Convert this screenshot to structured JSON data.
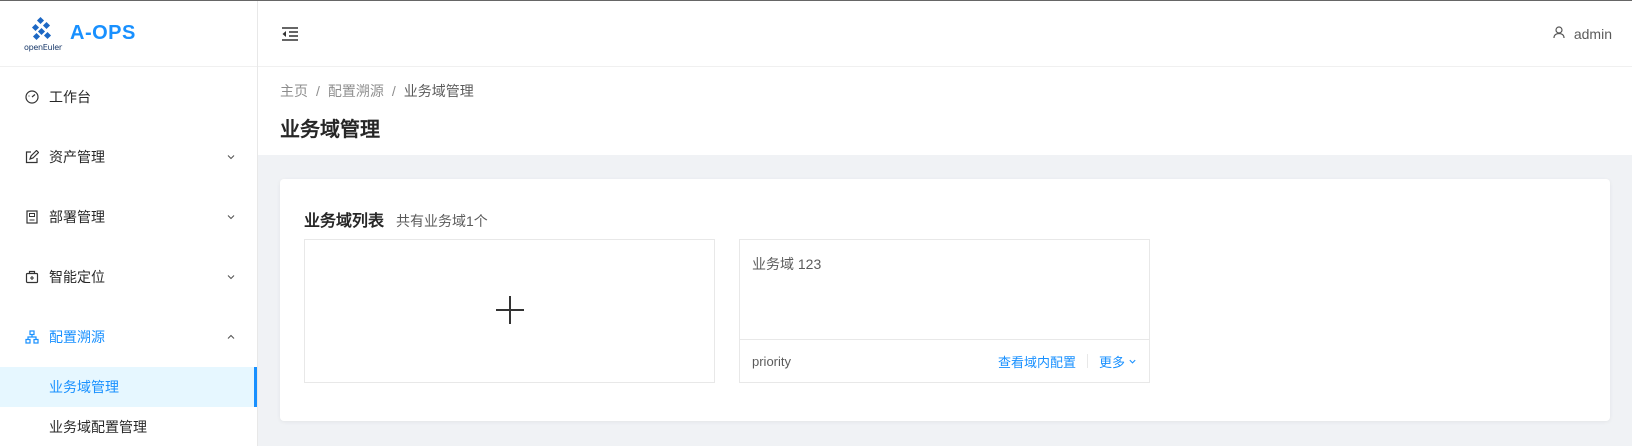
{
  "app": {
    "logo_small": "openEuler",
    "name": "A-OPS"
  },
  "sidebar": {
    "items": [
      {
        "label": "工作台",
        "icon": "dashboard-icon"
      },
      {
        "label": "资产管理",
        "icon": "edit-icon"
      },
      {
        "label": "部署管理",
        "icon": "deploy-icon"
      },
      {
        "label": "智能定位",
        "icon": "medicine-box-icon"
      },
      {
        "label": "配置溯源",
        "icon": "cluster-icon"
      }
    ],
    "subitems": [
      {
        "label": "业务域管理"
      },
      {
        "label": "业务域配置管理"
      }
    ]
  },
  "topbar": {
    "user": "admin"
  },
  "breadcrumb": [
    "主页",
    "/",
    "配置溯源",
    "/",
    "业务域管理"
  ],
  "page": {
    "title": "业务域管理"
  },
  "card": {
    "title": "业务域列表",
    "subtitle": "共有业务域1个",
    "domains": [
      {
        "name": "业务域 123",
        "priority": "priority",
        "view_action": "查看域内配置",
        "more_action": "更多"
      }
    ]
  },
  "colors": {
    "accent": "#1890ff",
    "selected_bg": "#e6f7ff",
    "page_bg": "#f0f2f5"
  }
}
